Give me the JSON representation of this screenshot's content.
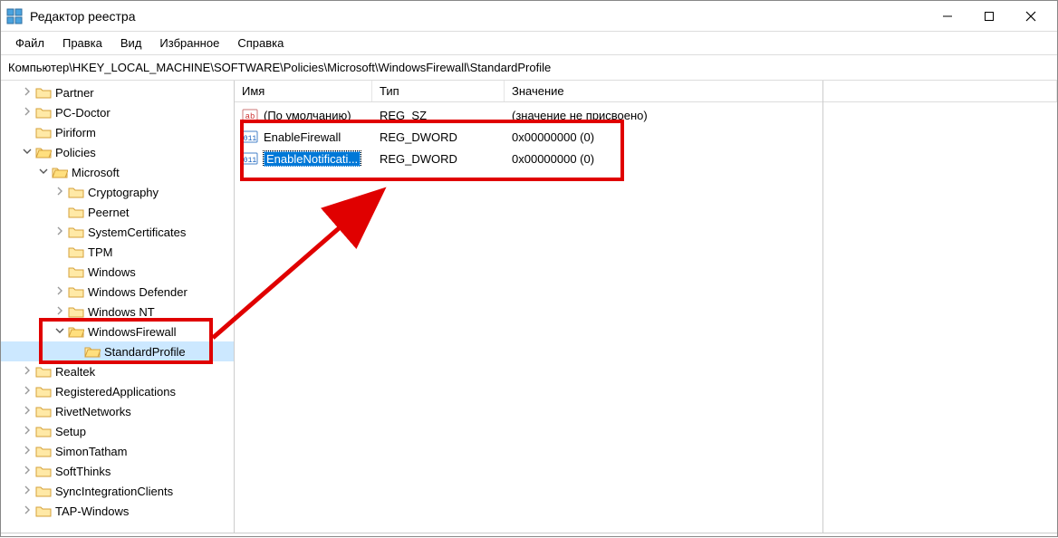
{
  "window": {
    "title": "Редактор реестра"
  },
  "menu": {
    "file": "Файл",
    "edit": "Правка",
    "view": "Вид",
    "favorites": "Избранное",
    "help": "Справка"
  },
  "addressbar": "Компьютер\\HKEY_LOCAL_MACHINE\\SOFTWARE\\Policies\\Microsoft\\WindowsFirewall\\StandardProfile",
  "columns": {
    "name": "Имя",
    "type": "Тип",
    "value": "Значение"
  },
  "values": [
    {
      "name": "(По умолчанию)",
      "type": "REG_SZ",
      "data": "(значение не присвоено)",
      "icon": "string",
      "selected": false
    },
    {
      "name": "EnableFirewall",
      "type": "REG_DWORD",
      "data": "0x00000000 (0)",
      "icon": "binary",
      "selected": false
    },
    {
      "name": "EnableNotificati...",
      "type": "REG_DWORD",
      "data": "0x00000000 (0)",
      "icon": "binary",
      "selected": true
    }
  ],
  "tree": [
    {
      "depth": 1,
      "exp": ">",
      "label": "Partner",
      "open": false
    },
    {
      "depth": 1,
      "exp": ">",
      "label": "PC-Doctor",
      "open": false
    },
    {
      "depth": 1,
      "exp": "",
      "label": "Piriform",
      "open": false
    },
    {
      "depth": 1,
      "exp": "v",
      "label": "Policies",
      "open": true
    },
    {
      "depth": 2,
      "exp": "v",
      "label": "Microsoft",
      "open": true
    },
    {
      "depth": 3,
      "exp": ">",
      "label": "Cryptography",
      "open": false
    },
    {
      "depth": 3,
      "exp": "",
      "label": "Peernet",
      "open": false
    },
    {
      "depth": 3,
      "exp": ">",
      "label": "SystemCertificates",
      "open": false
    },
    {
      "depth": 3,
      "exp": "",
      "label": "TPM",
      "open": false
    },
    {
      "depth": 3,
      "exp": "",
      "label": "Windows",
      "open": false
    },
    {
      "depth": 3,
      "exp": ">",
      "label": "Windows Defender",
      "open": false
    },
    {
      "depth": 3,
      "exp": ">",
      "label": "Windows NT",
      "open": false
    },
    {
      "depth": 3,
      "exp": "v",
      "label": "WindowsFirewall",
      "open": true
    },
    {
      "depth": 4,
      "exp": "",
      "label": "StandardProfile",
      "open": true,
      "selected": true
    },
    {
      "depth": 1,
      "exp": ">",
      "label": "Realtek",
      "open": false
    },
    {
      "depth": 1,
      "exp": ">",
      "label": "RegisteredApplications",
      "open": false
    },
    {
      "depth": 1,
      "exp": ">",
      "label": "RivetNetworks",
      "open": false
    },
    {
      "depth": 1,
      "exp": ">",
      "label": "Setup",
      "open": false
    },
    {
      "depth": 1,
      "exp": ">",
      "label": "SimonTatham",
      "open": false
    },
    {
      "depth": 1,
      "exp": ">",
      "label": "SoftThinks",
      "open": false
    },
    {
      "depth": 1,
      "exp": ">",
      "label": "SyncIntegrationClients",
      "open": false
    },
    {
      "depth": 1,
      "exp": ">",
      "label": "TAP-Windows",
      "open": false
    }
  ]
}
